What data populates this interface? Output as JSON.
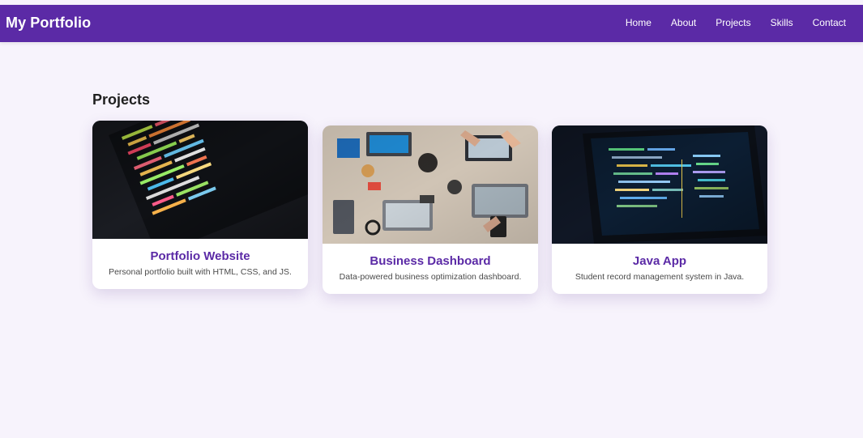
{
  "header": {
    "brand": "My Portfolio",
    "nav": [
      "Home",
      "About",
      "Projects",
      "Skills",
      "Contact"
    ]
  },
  "main": {
    "title": "Projects",
    "projects": [
      {
        "title": "Portfolio Website",
        "description": "Personal portfolio built with HTML, CSS, and JS."
      },
      {
        "title": "Business Dashboard",
        "description": "Data-powered business optimization dashboard."
      },
      {
        "title": "Java App",
        "description": "Student record management system in Java."
      }
    ]
  },
  "colors": {
    "header_bg": "#5b2aa6",
    "accent": "#5b2aa6",
    "page_bg": "#f7f3fc"
  }
}
